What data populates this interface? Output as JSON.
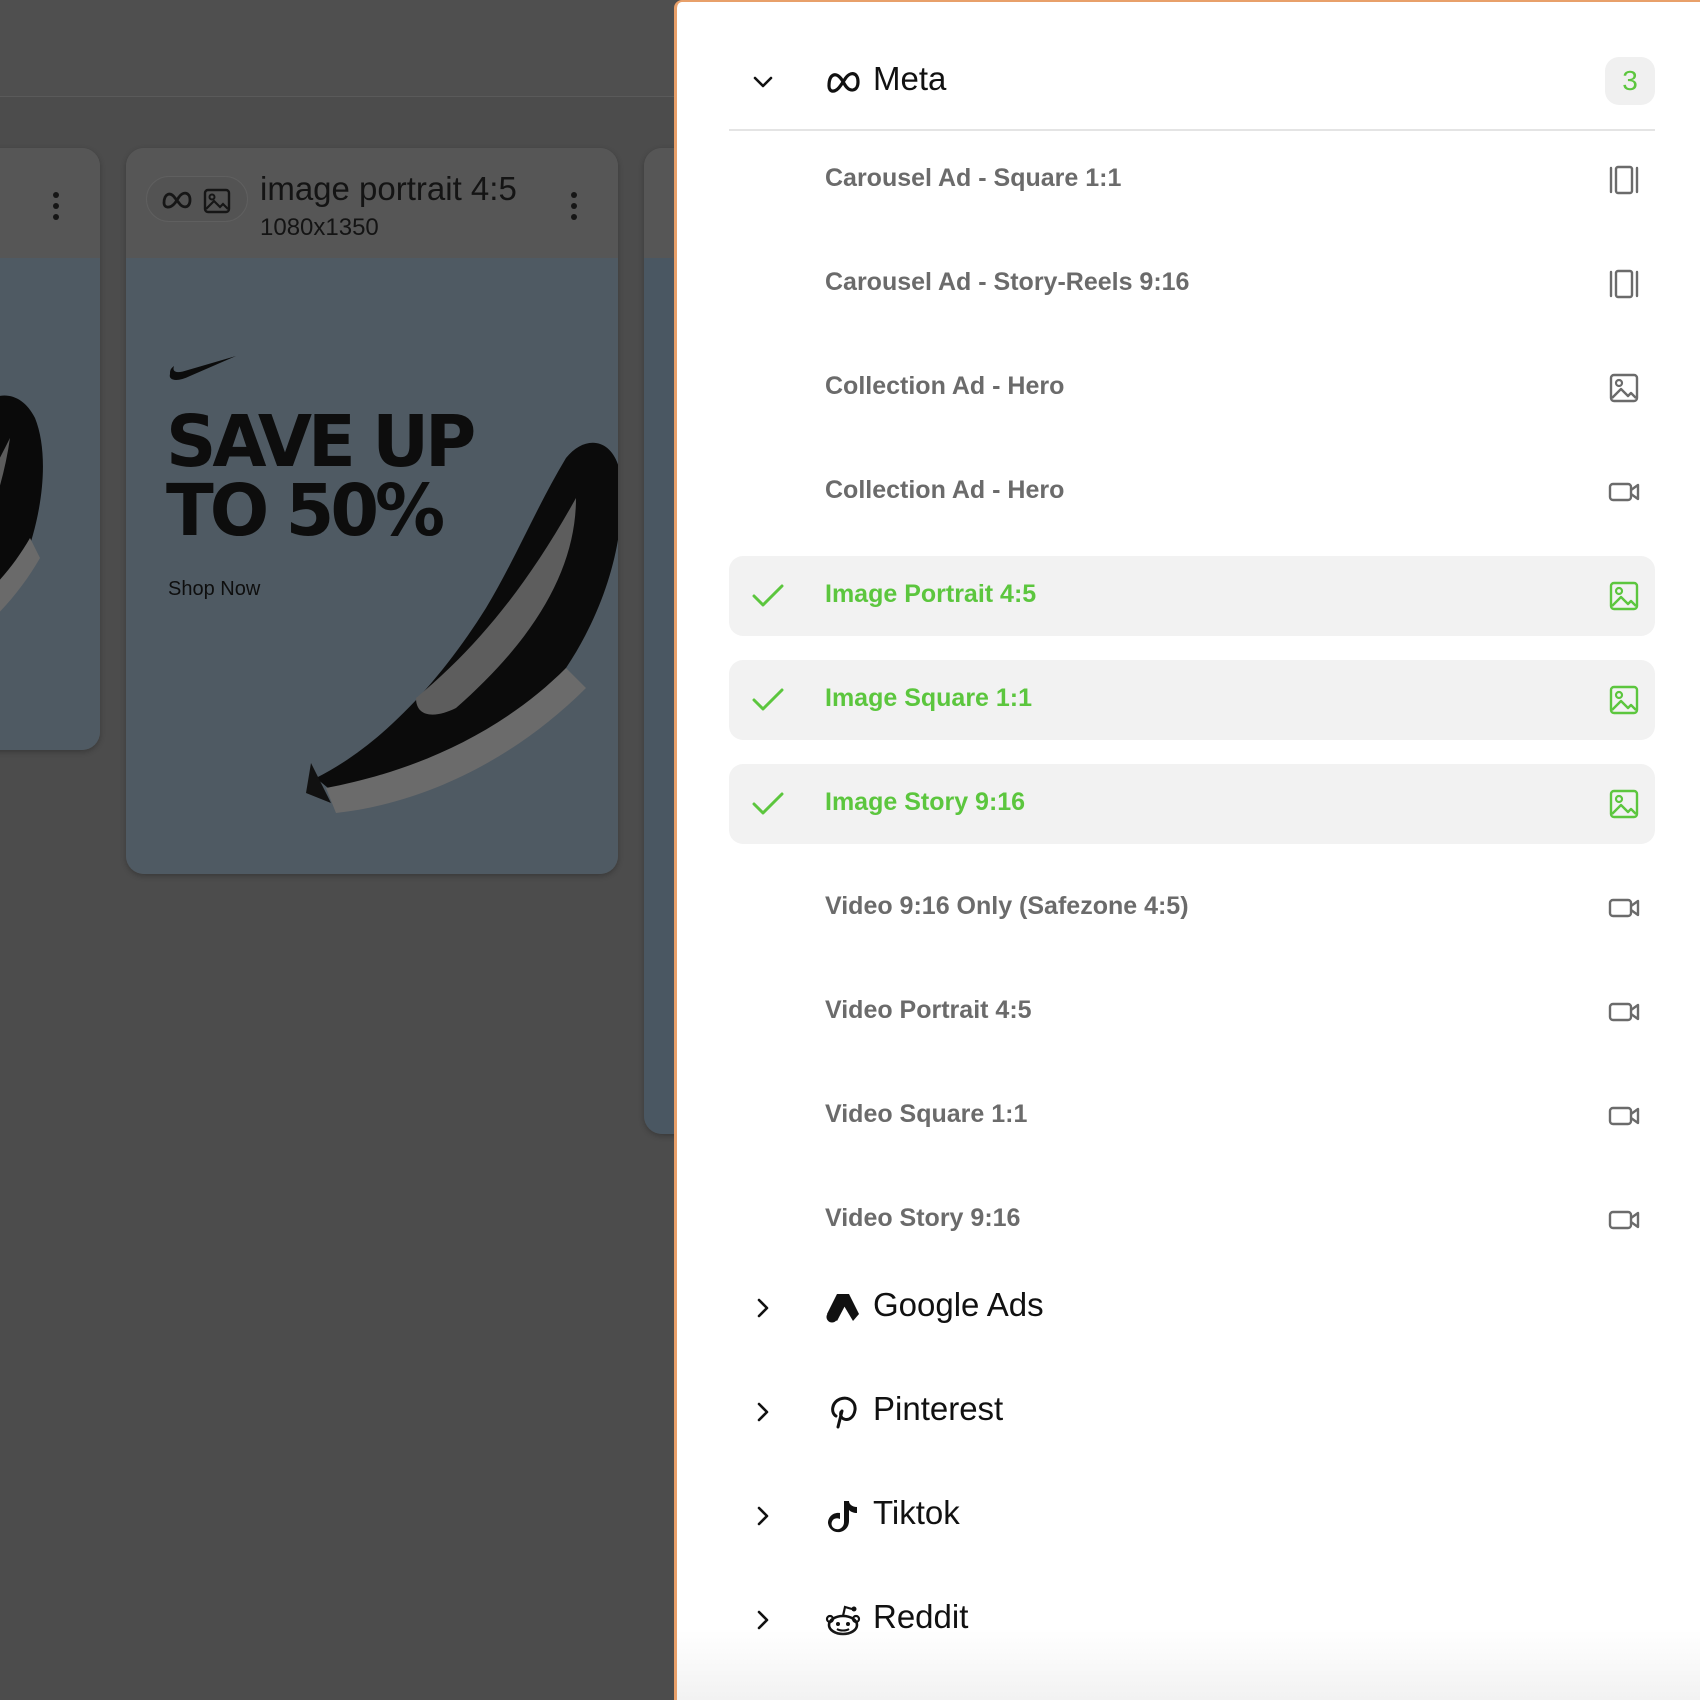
{
  "background": {
    "card": {
      "title": "image portrait 4:5",
      "size": "1080x1350",
      "headline": "SAVE UP\nTO 50%",
      "cta": "Shop Now"
    }
  },
  "panel": {
    "accent_color": "#5cc63e",
    "border_color": "#e8a06a",
    "groups": [
      {
        "name": "Meta",
        "icon": "meta-icon",
        "expanded": true,
        "count": "3",
        "items": [
          {
            "label": "Carousel Ad - Square 1:1",
            "type_icon": "carousel-icon",
            "selected": false
          },
          {
            "label": "Carousel Ad - Story-Reels 9:16",
            "type_icon": "carousel-icon",
            "selected": false
          },
          {
            "label": "Collection Ad - Hero",
            "type_icon": "image-icon",
            "selected": false
          },
          {
            "label": "Collection Ad - Hero",
            "type_icon": "video-icon",
            "selected": false
          },
          {
            "label": "Image Portrait 4:5",
            "type_icon": "image-icon",
            "selected": true
          },
          {
            "label": "Image Square 1:1",
            "type_icon": "image-icon",
            "selected": true
          },
          {
            "label": "Image Story 9:16",
            "type_icon": "image-icon",
            "selected": true
          },
          {
            "label": "Video 9:16 Only (Safezone 4:5)",
            "type_icon": "video-icon",
            "selected": false
          },
          {
            "label": "Video Portrait 4:5",
            "type_icon": "video-icon",
            "selected": false
          },
          {
            "label": "Video Square 1:1",
            "type_icon": "video-icon",
            "selected": false
          },
          {
            "label": "Video Story 9:16",
            "type_icon": "video-icon",
            "selected": false
          }
        ]
      },
      {
        "name": "Google Ads",
        "icon": "google-ads-icon",
        "expanded": false
      },
      {
        "name": "Pinterest",
        "icon": "pinterest-icon",
        "expanded": false
      },
      {
        "name": "Tiktok",
        "icon": "tiktok-icon",
        "expanded": false
      },
      {
        "name": "Reddit",
        "icon": "reddit-icon",
        "expanded": false
      }
    ]
  }
}
